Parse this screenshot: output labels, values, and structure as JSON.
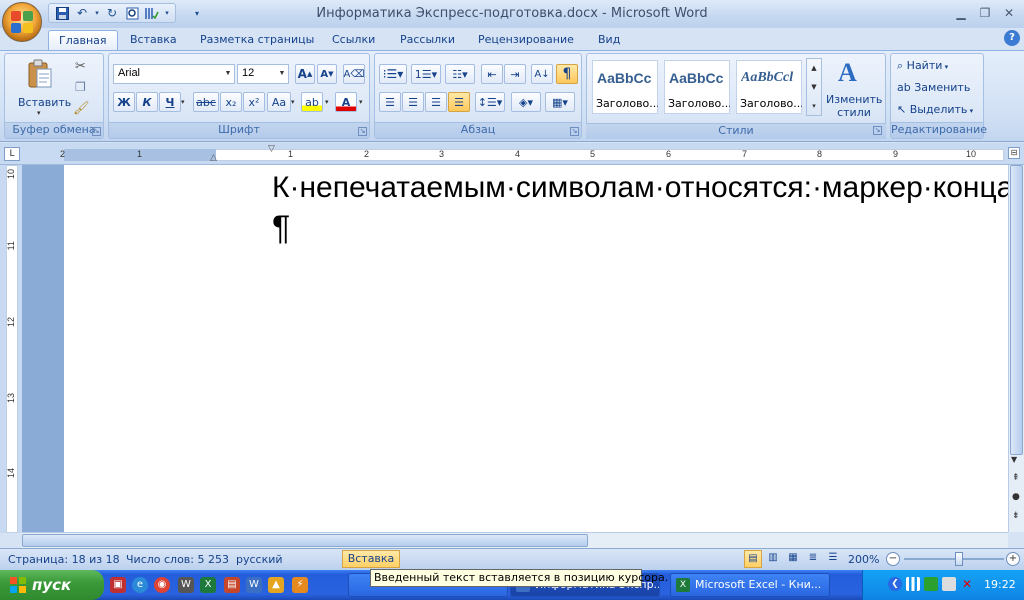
{
  "window": {
    "title": "Информатика Экспресс-подготовка.docx - Microsoft Word"
  },
  "qat": {
    "icons": [
      "save-icon",
      "undo-icon",
      "redo-icon",
      "print-preview-icon",
      "spelling-icon",
      "customize-icon"
    ]
  },
  "tabs": [
    "Главная",
    "Вставка",
    "Разметка страницы",
    "Ссылки",
    "Рассылки",
    "Рецензирование",
    "Вид"
  ],
  "ribbon": {
    "clipboard": {
      "paste_label": "Вставить",
      "caption": "Буфер обмена"
    },
    "font": {
      "name": "Arial",
      "size": "12",
      "caption": "Шрифт",
      "bold": "Ж",
      "italic": "К",
      "underline": "Ч",
      "strike": "abc",
      "sub": "x₂",
      "sup": "x²",
      "case": "Aa",
      "grow": "A",
      "shrink": "A",
      "color_letter": "A"
    },
    "paragraph": {
      "caption": "Абзац",
      "pilcrow": "¶"
    },
    "styles": {
      "caption": "Стили",
      "cards": [
        {
          "sample": "AaBbCc",
          "name": "Заголово..."
        },
        {
          "sample": "AaBbCc",
          "name": "Заголово..."
        },
        {
          "sample": "AaBbCcl",
          "name": "Заголово..."
        }
      ],
      "change_label_1": "Изменить",
      "change_label_2": "стили"
    },
    "editing": {
      "caption": "Редактирование",
      "find": "Найти",
      "replace": "Заменить",
      "select": "Выделить"
    }
  },
  "ruler": {
    "h_numbers": [
      "2",
      "1",
      "1",
      "2",
      "3",
      "4",
      "5",
      "6",
      "7",
      "8",
      "9",
      "10"
    ],
    "v_numbers": [
      "10",
      "11",
      "12",
      "13",
      "14"
    ]
  },
  "document": {
    "line1": "К·непечатаемым·символам·относятся:·маркер·конца",
    "paragraph_mark": "¶"
  },
  "status": {
    "page": "Страница: 18 из 18",
    "words": "Число слов: 5 253",
    "lang": "русский",
    "mode": "Вставка",
    "zoom": "200%"
  },
  "tooltip": "Введенный текст вставляется в позицию курсора.",
  "taskbar": {
    "start": "пуск",
    "tasks": [
      "Информатика Экспр...",
      "Microsoft Excel - Кни..."
    ],
    "lang": "RL",
    "time": "19:22"
  },
  "colors": {
    "accent": "#15428b",
    "ribbon": "#dae6f6",
    "taskbar": "#245ddb",
    "start": "#3c9a3a",
    "highlight": "#ffd066"
  }
}
